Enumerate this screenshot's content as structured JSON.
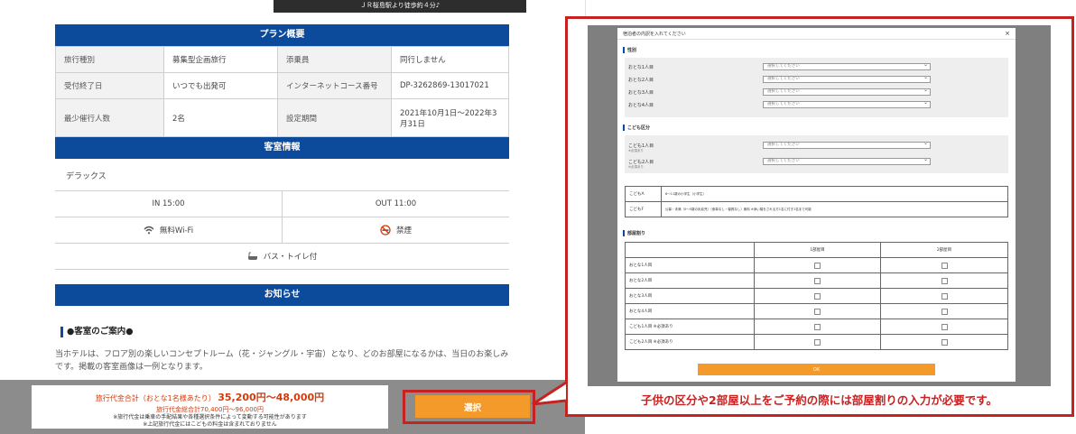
{
  "hero_caption": "ＪＲ桜島駅より徒歩約４分♪",
  "plan": {
    "heading": "プラン概要",
    "rows": [
      [
        "旅行種別",
        "募集型企画旅行",
        "添乗員",
        "同行しません"
      ],
      [
        "受付終了日",
        "いつでも出発可",
        "インターネットコース番号",
        "DP-3262869-13017021"
      ],
      [
        "最少催行人数",
        "2名",
        "設定期間",
        "2021年10月1日〜2022年3月31日"
      ]
    ]
  },
  "room": {
    "heading": "客室情報",
    "name": "デラックス",
    "checkin": "IN 15:00",
    "checkout": "OUT 11:00",
    "wifi": "無料Wi-Fi",
    "smoking": "禁煙",
    "bath": "バス・トイレ付"
  },
  "notice": {
    "heading": "お知らせ",
    "title": "●客室のご案内●",
    "body": "当ホテルは、フロア別の楽しいコンセプトルーム（花・ジャングル・宇宙）となり、どのお部屋になるかは、当日のお楽しみです。掲載の客室画像は一例となります。"
  },
  "price": {
    "label": "旅行代金合計（おとな1名様あたり）",
    "amount": "35,200円〜48,000円",
    "total": "旅行代金総合計70,400円〜96,000円",
    "note1": "※旅行代金は乗車の手配結果や各種選択条件によって変動する可能性があります",
    "note2": "※上記旅行代金にはこどもの料金は含まれておりません"
  },
  "select_button": "選択",
  "modal": {
    "title": "宿泊者の内訳を入れてください",
    "close": "×",
    "adult_section": "性別",
    "adults": [
      "おとな1人目",
      "おとな2人目",
      "おとな3人目",
      "おとな4人目"
    ],
    "select_placeholder": "選択してください",
    "child_section": "こども区分",
    "children": [
      {
        "label": "こども1人目",
        "sub": "※必須あり"
      },
      {
        "label": "こども2人目",
        "sub": "※必須あり"
      }
    ],
    "child_types": [
      {
        "name": "こどもA",
        "desc": "6〜11歳の小学生（小学生）"
      },
      {
        "name": "こどもF",
        "desc": "公募・未満（0〜5歳の乳幼児）（食事なし・寝具なし）無料 ※添い寝をされる方1名に付き1名まで可能"
      }
    ],
    "room_section": "部屋割り",
    "room_cols": [
      "1部屋目",
      "2部屋目"
    ],
    "room_rows": [
      "おとな1人目",
      "おとな2人目",
      "おとな3人目",
      "おとな4人目",
      "こども1人目 ※必須あり",
      "こども2人目 ※必須あり"
    ],
    "ok_button": "OK"
  },
  "caption": "子供の区分や2部屋以上をご予約の際には部屋割りの入力が必要です。",
  "colors": {
    "navy": "#0c4a9c",
    "orange": "#f39a2b",
    "red": "#c62222"
  }
}
